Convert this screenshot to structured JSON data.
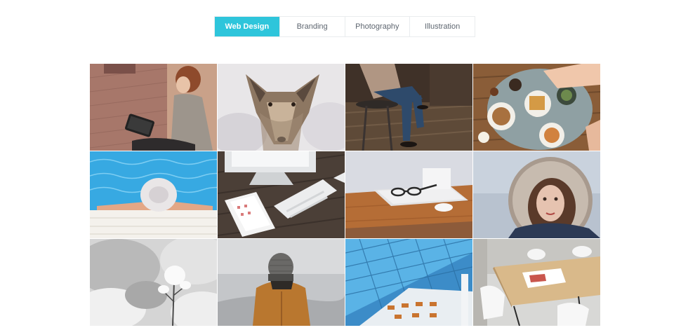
{
  "filters": {
    "tabs": [
      {
        "label": "Web Design",
        "active": true
      },
      {
        "label": "Branding",
        "active": false
      },
      {
        "label": "Photography",
        "active": false
      },
      {
        "label": "Illustration",
        "active": false
      }
    ],
    "accent_color": "#2ec5db"
  },
  "gallery": {
    "items": [
      {
        "subject": "woman-reading-tablet-photo"
      },
      {
        "subject": "coyote-in-snow-photo"
      },
      {
        "subject": "person-on-bar-stool-photo"
      },
      {
        "subject": "breakfast-table-photo"
      },
      {
        "subject": "swimmer-in-pool-photo"
      },
      {
        "subject": "desk-with-keyboard-photo"
      },
      {
        "subject": "glasses-on-laptop-photo"
      },
      {
        "subject": "woman-in-fur-hood-photo"
      },
      {
        "subject": "snowy-plant-photo"
      },
      {
        "subject": "man-in-beanie-photo"
      },
      {
        "subject": "blue-glass-atrium-photo"
      },
      {
        "subject": "table-and-chairs-photo"
      }
    ]
  }
}
